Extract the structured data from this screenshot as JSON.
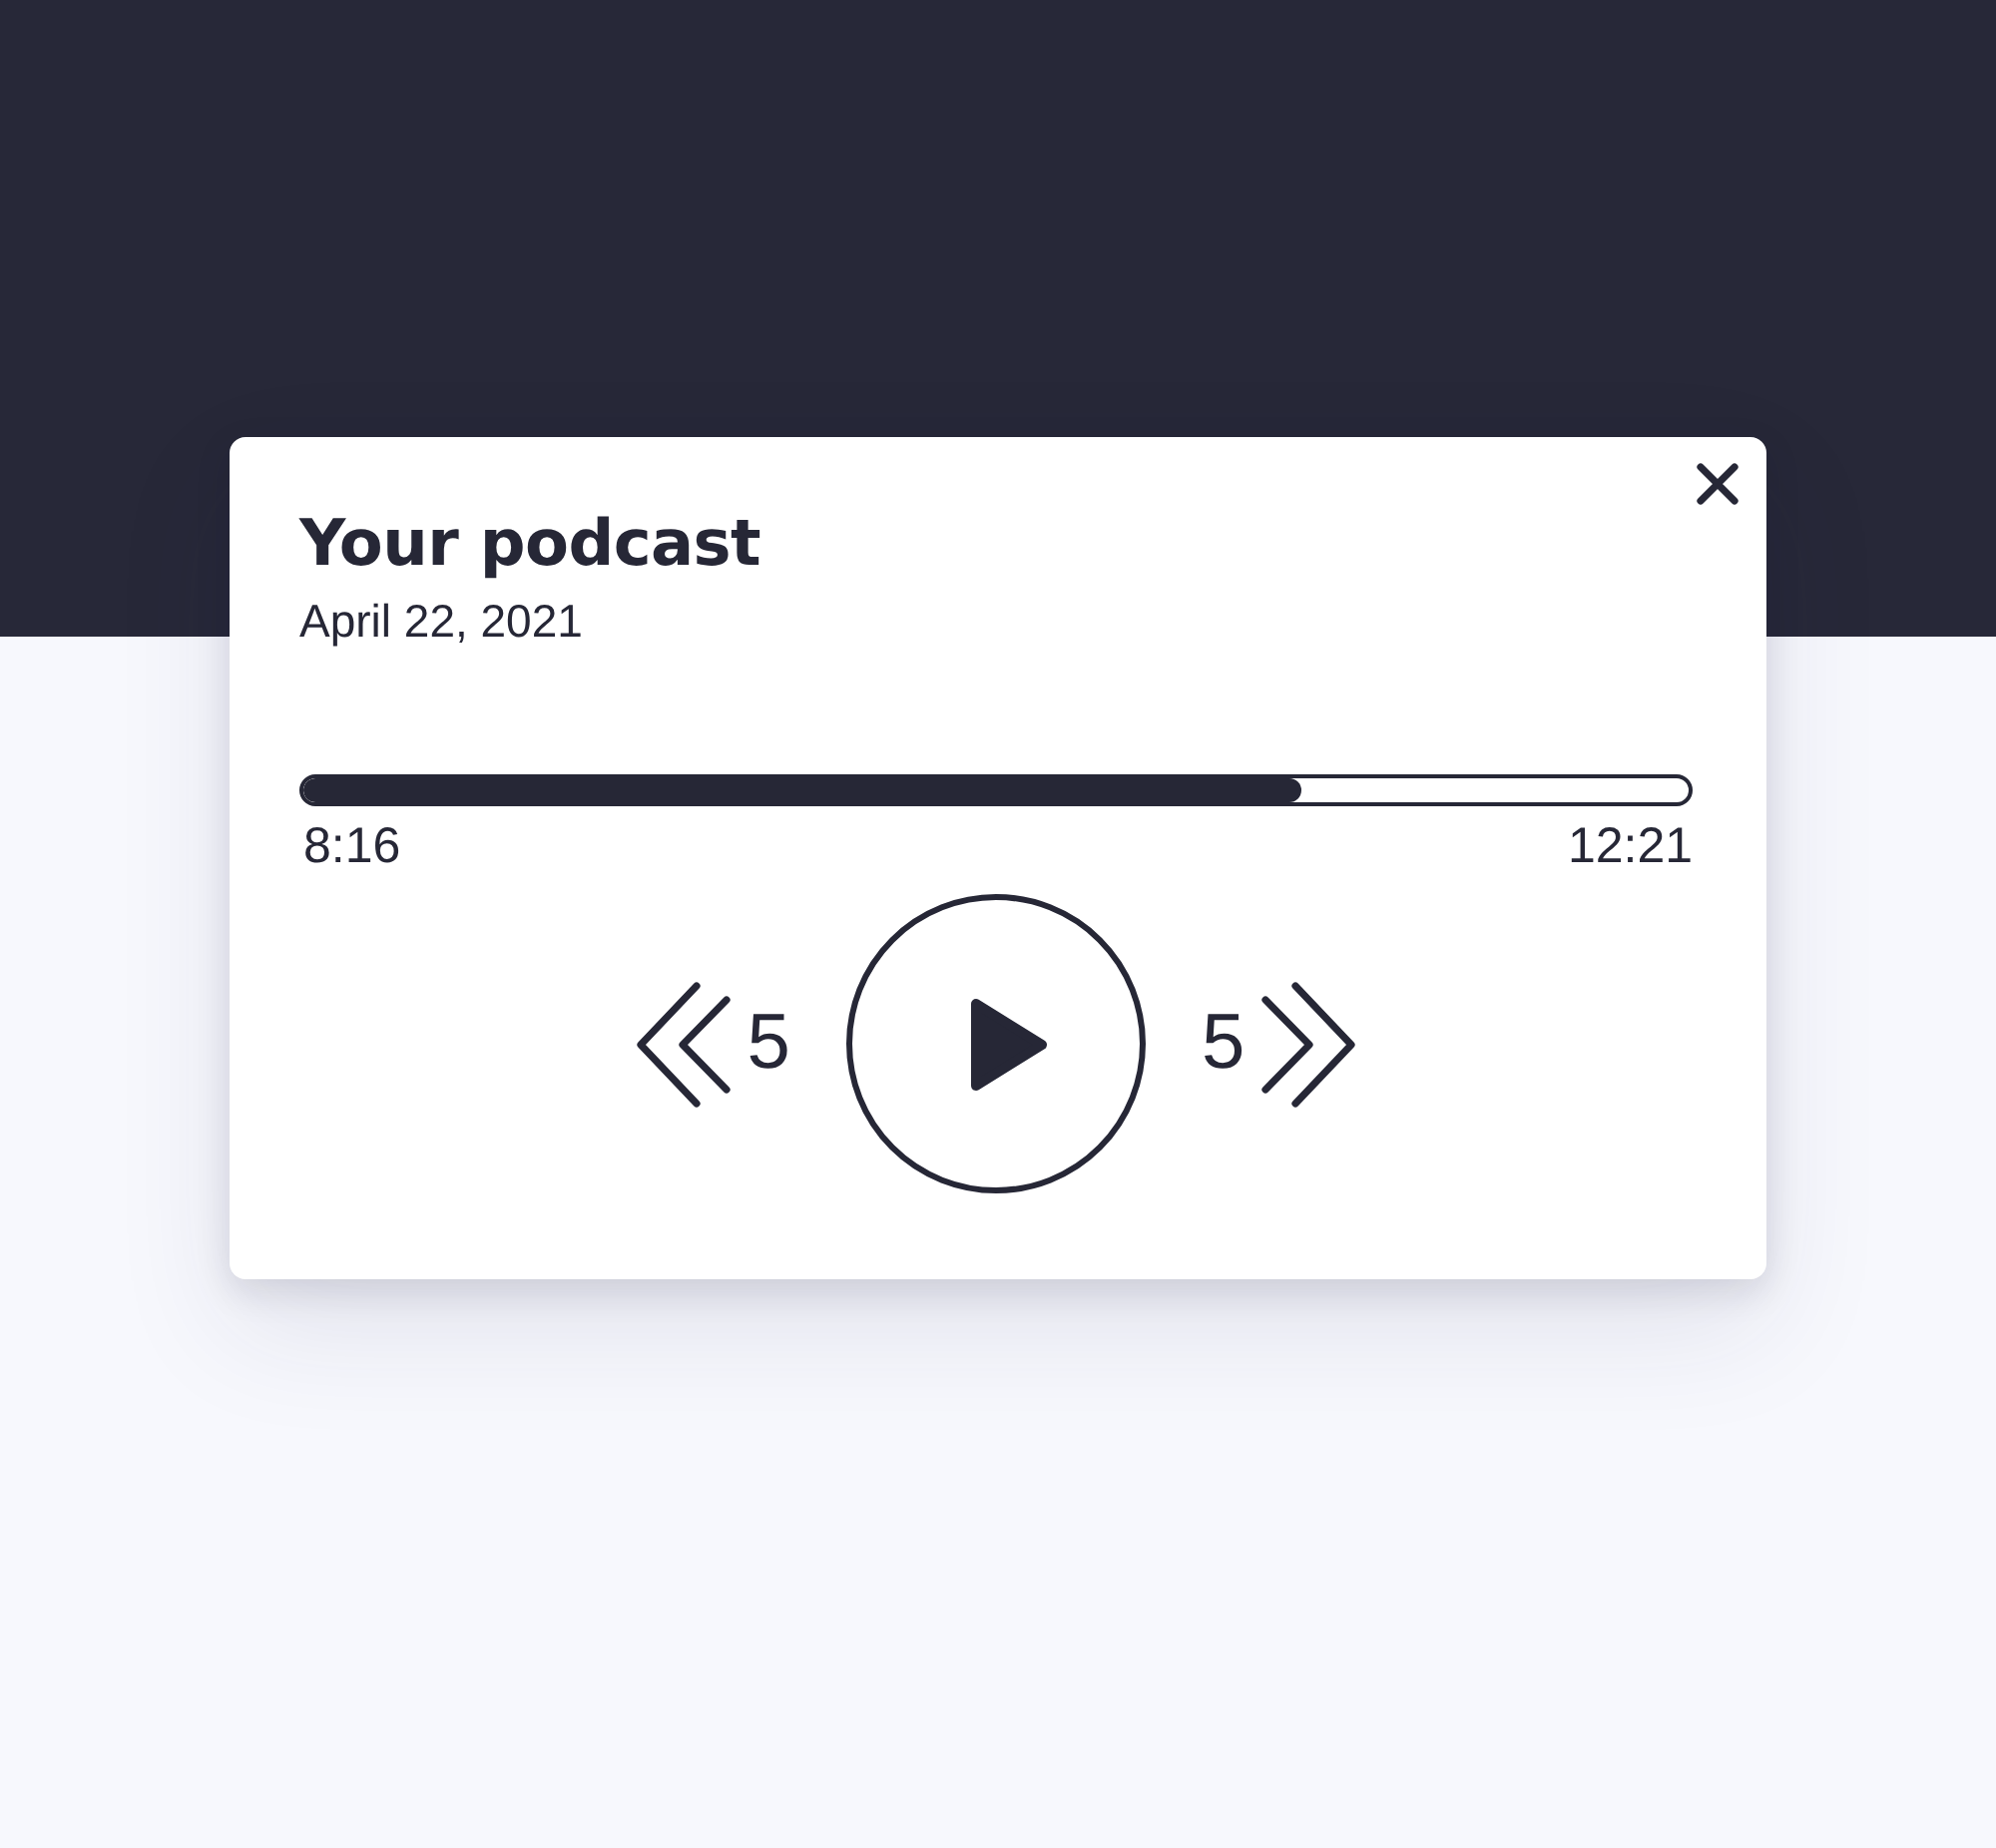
{
  "player": {
    "title": "Your podcast",
    "date": "April 22, 2021",
    "progress": {
      "level": 0.72,
      "elapsed": "8:16",
      "duration": "12:21"
    },
    "controls": [
      {
        "kind": "rewind",
        "label": "5"
      },
      {
        "kind": "play"
      },
      {
        "kind": "forward",
        "label": "5"
      }
    ]
  }
}
